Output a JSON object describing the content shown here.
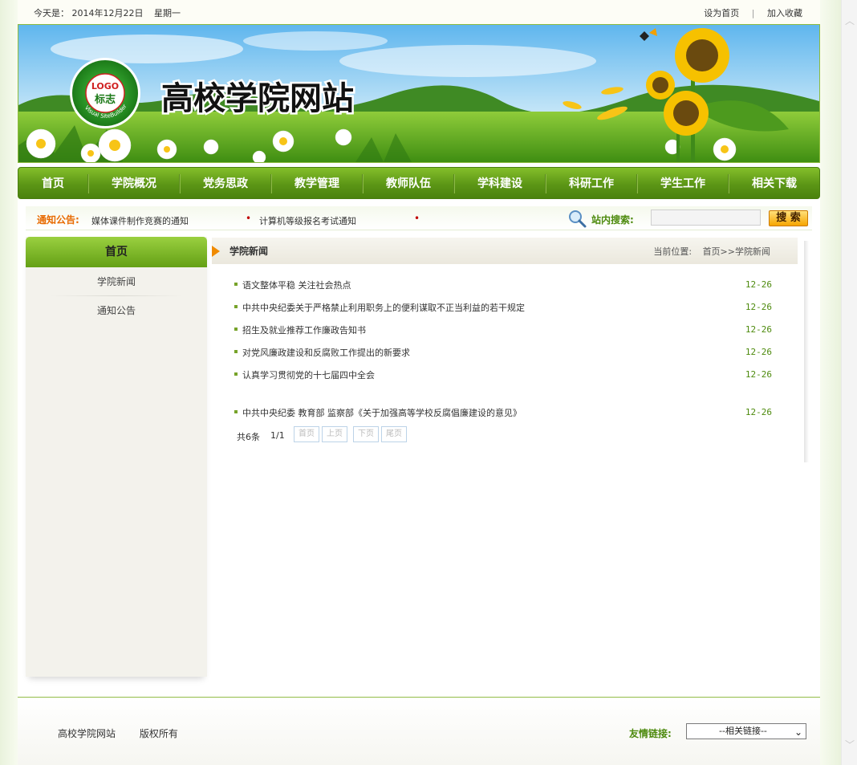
{
  "topbar": {
    "date_label": "今天是：",
    "date_value": "2014年12月22日",
    "weekday": "星期一",
    "set_home": "设为首页",
    "separator": "|",
    "add_favorite": "加入收藏"
  },
  "banner": {
    "site_title": "高校学院网站",
    "logo_text": "LOGO",
    "logo_sub": "标志",
    "logo_ring": "Visual SiteBuilder"
  },
  "nav": {
    "items": [
      "首页",
      "学院概况",
      "党务思政",
      "教学管理",
      "教师队伍",
      "学科建设",
      "科研工作",
      "学生工作",
      "相关下载"
    ]
  },
  "notice": {
    "label": "通知公告:",
    "items": [
      "媒体课件制作竞赛的通知",
      "计算机等级报名考试通知"
    ],
    "search_label": "站内搜索:",
    "search_value": "",
    "search_button": "搜 索"
  },
  "sidebar": {
    "title": "首页",
    "items": [
      "学院新闻",
      "通知公告"
    ]
  },
  "main": {
    "section_title": "学院新闻",
    "crumb_label": "当前位置:",
    "crumb_path": "首页>>学院新闻",
    "news": [
      {
        "title": "语文整体平稳 关注社会热点",
        "date": "12-26"
      },
      {
        "title": "中共中央纪委关于严格禁止利用职务上的便利谋取不正当利益的若干规定",
        "date": "12-26"
      },
      {
        "title": "招生及就业推荐工作廉政告知书",
        "date": "12-26"
      },
      {
        "title": "对党风廉政建设和反腐败工作提出的新要求",
        "date": "12-26"
      },
      {
        "title": "认真学习贯彻党的十七届四中全会",
        "date": "12-26"
      },
      {
        "title": "中共中央纪委 教育部 监察部《关于加强高等学校反腐倡廉建设的意见》",
        "date": "12-26"
      }
    ],
    "pager": {
      "total": "共6条",
      "page": "1/1",
      "first": "首页",
      "prev": "上页",
      "next": "下页",
      "last": "尾页"
    }
  },
  "footer": {
    "site_name": "高校学院网站",
    "rights": "版权所有",
    "links_label": "友情链接:",
    "links_select": "--相关链接--"
  },
  "colors": {
    "nav_green": "#5c9616",
    "accent_orange": "#e86a00",
    "link_green": "#4d8a0d"
  }
}
